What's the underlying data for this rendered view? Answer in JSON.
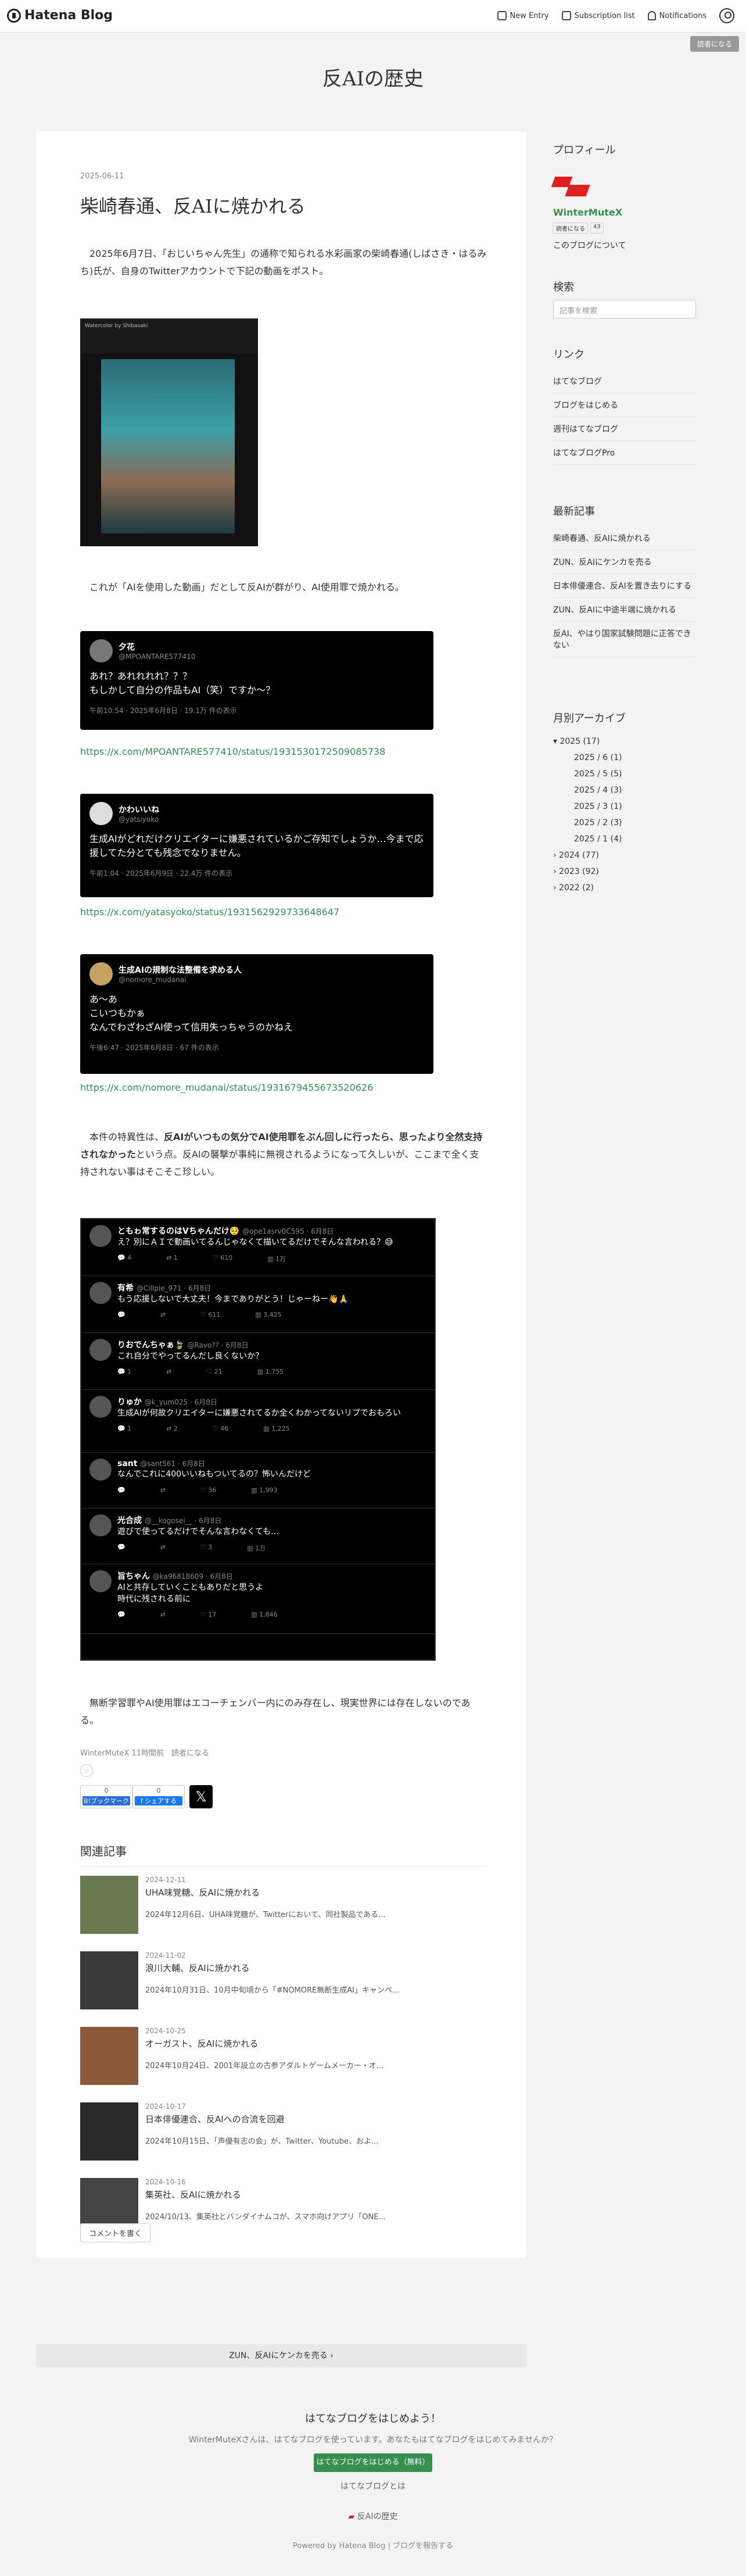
{
  "topbar": {
    "logo": "Hatena Blog",
    "new_entry": "New Entry",
    "subscription": "Subscription list",
    "notifications": "Notifications",
    "reader_btn": "読者になる"
  },
  "blog": {
    "title": "反AIの歴史"
  },
  "article": {
    "date": "2025-06-11",
    "title": "柴崎春通、反AIに焼かれる",
    "para1": "2025年6月7日、「おじいちゃん先生」の通称で知られる水彩画家の柴崎春通(しばさき・はるみち)氏が、自身のTwitterアカウントで下記の動画をポスト。",
    "image1_top": "Watercolor by Shibasaki",
    "para2": "これが「AIを使用した動画」だとして反AIが群がり、AI使用罪で焼かれる。",
    "tweet1": {
      "name": "夕花",
      "handle": "@MPOANTARE577410",
      "text": "あれ？あれれれれ？？？\nもしかして自分の作品もAI（笑）ですか〜？",
      "meta": "午前10:54 · 2025年6月8日 · 19.1万 件の表示"
    },
    "link1": "https://x.com/MPOANTARE577410/status/1931530172509085738",
    "tweet2": {
      "name": "かわいいね",
      "handle": "@yatsiyoko",
      "text": "生成AIがどれだけクリエイターに嫌悪されているかご存知でしょうか…今まで応援してた分とても残念でなりません。",
      "meta": "午前1:04 · 2025年6月9日 · 22.4万 件の表示"
    },
    "link2": "https://x.com/yatasyoko/status/1931562929733648647",
    "tweet3": {
      "name": "生成AIの規制な法整備を求める人",
      "handle": "@nomore_mudanai",
      "text": "あ〜あ\nこいつもかぁ\nなんでわざわざAI使って信用失っちゃうのかねえ",
      "meta": "午後6:47 · 2025年6月8日 · 67 件の表示"
    },
    "link3": "https://x.com/nomore_mudanai/status/1931679455673520626",
    "para3a": "本件の特異性は、",
    "para3b": "反AIがいつもの気分でAI使用罪をぶん回しに行ったら、思ったより全然支持されなかった",
    "para3c": "という点。反AIの襲撃が事純に無視されるようになって久しいが、ここまで全く支持されない事はそこそこ珍しい。",
    "replies": [
      {
        "name": "ともゎ常するのはVちゃんだけ🥺",
        "hd": "@ope1asrv0C595 · 6月8日",
        "text": "え？別にＡＩで動画いてるんじゃなくて描いてるだけでそんな言われる？😅",
        "c": "4",
        "r": "1",
        "l": "610",
        "v": "1万"
      },
      {
        "name": "有希",
        "hd": "@Cillpie_971 · 6月8日",
        "text": "もう応援しないで大丈夫！今までありがとう！じゃーねー👋🙏",
        "c": "",
        "r": "",
        "l": "611",
        "v": "3,425"
      },
      {
        "name": "りおでんちゃぁ🍃",
        "hd": "@Ravo?? · 6月8日",
        "text": "これ自分でやってるんだし良くないか？",
        "c": "1",
        "r": "",
        "l": "21",
        "v": "1,755"
      },
      {
        "name": "りゅか",
        "hd": "@k_yum025 · 6月8日",
        "text": "生成AIが何故クリエイターに嫌悪されてるか全くわかってないリプでおもろい",
        "c": "1",
        "r": "2",
        "l": "46",
        "v": "1,225"
      },
      {
        "name": "sant",
        "hd": "@sant561 · 6月8日",
        "text": "なんでこれに400いいねもついてるの？怖いんだけど",
        "c": "",
        "r": "",
        "l": "36",
        "v": "1,993"
      },
      {
        "name": "光合成",
        "hd": "@__kogosei__ · 6月8日",
        "text": "遊びで使ってるだけでそんな言わなくても…",
        "c": "",
        "r": "",
        "l": "3",
        "v": "1万"
      },
      {
        "name": "旨ちゃん",
        "hd": "@ka96818609 · 6月8日",
        "text": "AIと共存していくこともありだと思うよ\n時代に残される前に",
        "c": "",
        "r": "",
        "l": "17",
        "v": "1,846"
      }
    ],
    "para4": "無断学習罪やAI使用罪はエコーチェンバー内にのみ存在し、現実世界には存在しないのである。",
    "byline": "WinterMuteX 11時間前　読者になる",
    "star": "☆",
    "share_bm": {
      "count": "0",
      "label": "B!ブックマーク"
    },
    "share_fb": {
      "count": "0",
      "label": "f シェアする"
    },
    "x_label": "𝕏"
  },
  "related": {
    "heading": "関連記事",
    "items": [
      {
        "date": "2024-12-11",
        "title": "UHA味覚糖、反AIに焼かれる",
        "snippet": "2024年12月6日、UHA味覚糖が、Twitterにおいて、同社製品である..."
      },
      {
        "date": "2024-11-02",
        "title": "浪川大輔、反AIに焼かれる",
        "snippet": "2024年10月31日、10月中旬頃から「#NOMORE無断生成AI」キャンペ..."
      },
      {
        "date": "2024-10-25",
        "title": "オーガスト、反AIに焼かれる",
        "snippet": "2024年10月24日、2001年設立の古参アダルトゲームメーカー・オ..."
      },
      {
        "date": "2024-10-17",
        "title": "日本俳優連合、反AIへの合流を回避",
        "snippet": "2024年10月15日、「声優有志の会」が、Twitter、Youtube、およ..."
      },
      {
        "date": "2024-10-16",
        "title": "集英社、反AIに焼かれる",
        "snippet": "2024/10/13、集英社とバンダイナムコが、スマホ向けアプリ「ONE..."
      }
    ]
  },
  "comment_btn": "コメントを書く",
  "pager": "ZUN、反AIにケンカを売る ›",
  "sidebar": {
    "profile_h": "プロフィール",
    "profile_name": "WinterMuteX",
    "reader_tag": "読者になる",
    "reader_count": "43",
    "about": "このブログについて",
    "search_h": "検索",
    "search_ph": "記事を検索",
    "links_h": "リンク",
    "links": [
      "はてなブログ",
      "ブログをはじめる",
      "週刊はてなブログ",
      "はてなブログPro"
    ],
    "recent_h": "最新記事",
    "recent": [
      "柴崎春通、反AIに焼かれる",
      "ZUN、反AIにケンカを売る",
      "日本俳優連合、反AIを置き去りにする",
      "ZUN、反AIに中途半端に焼かれる",
      "反AI、やはり国家試験問題に正答できない"
    ],
    "archive_h": "月別アーカイブ",
    "archive": [
      {
        "label": "▾ 2025 (17)",
        "indent": 0
      },
      {
        "label": "2025 / 6 (1)",
        "indent": 1
      },
      {
        "label": "2025 / 5 (5)",
        "indent": 1
      },
      {
        "label": "2025 / 4 (3)",
        "indent": 1
      },
      {
        "label": "2025 / 3 (1)",
        "indent": 1
      },
      {
        "label": "2025 / 2 (3)",
        "indent": 1
      },
      {
        "label": "2025 / 1 (4)",
        "indent": 1
      },
      {
        "label": "› 2024 (77)",
        "indent": 0
      },
      {
        "label": "› 2023 (92)",
        "indent": 0
      },
      {
        "label": "› 2022 (2)",
        "indent": 0
      }
    ]
  },
  "footer": {
    "heading": "はてなブログをはじめよう！",
    "text": "WinterMuteXさんは、はてなブログを使っています。あなたもはてなブログをはじめてみませんか？",
    "btn": "はてなブログをはじめる（無料）",
    "link": "はてなブログとは",
    "blog": "反AIの歴史",
    "powered": "Powered by Hatena Blog | ブログを報告する"
  },
  "colors": {
    "accent_green": "#35904d",
    "profile_red": "#e02020"
  }
}
